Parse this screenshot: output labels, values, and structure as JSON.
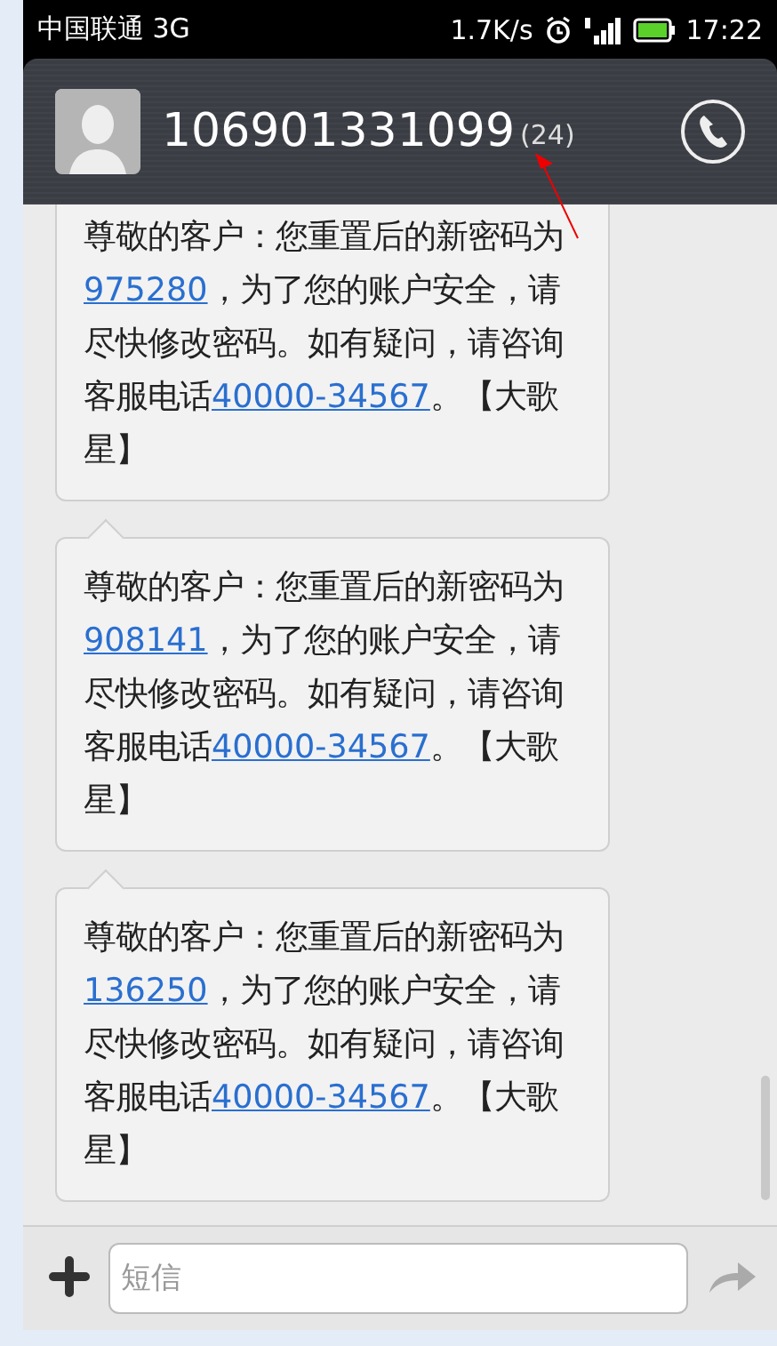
{
  "status_bar": {
    "carrier": "中国联通 3G",
    "speed": "1.7K/s",
    "time": "17:22"
  },
  "header": {
    "contact": "106901331099",
    "count": "(24)"
  },
  "messages": [
    {
      "segments": [
        {
          "kind": "text",
          "text": "尊敬的客户：您重置后的新密码为"
        },
        {
          "kind": "link",
          "text": "975280"
        },
        {
          "kind": "text",
          "text": "，为了您的账户安全，请尽快修改密码。如有疑问，请咨询客服电话"
        },
        {
          "kind": "link",
          "text": "40000-34567"
        },
        {
          "kind": "text",
          "text": "。【大歌星】"
        }
      ]
    },
    {
      "segments": [
        {
          "kind": "text",
          "text": "尊敬的客户：您重置后的新密码为"
        },
        {
          "kind": "link",
          "text": "908141"
        },
        {
          "kind": "text",
          "text": "，为了您的账户安全，请尽快修改密码。如有疑问，请咨询客服电话"
        },
        {
          "kind": "link",
          "text": "40000-34567"
        },
        {
          "kind": "text",
          "text": "。【大歌星】"
        }
      ]
    },
    {
      "segments": [
        {
          "kind": "text",
          "text": "尊敬的客户：您重置后的新密码为"
        },
        {
          "kind": "link",
          "text": "136250"
        },
        {
          "kind": "text",
          "text": "，为了您的账户安全，请尽快修改密码。如有疑问，请咨询客服电话"
        },
        {
          "kind": "link",
          "text": "40000-34567"
        },
        {
          "kind": "text",
          "text": "。【大歌星】"
        }
      ]
    }
  ],
  "composer": {
    "placeholder": "短信"
  }
}
